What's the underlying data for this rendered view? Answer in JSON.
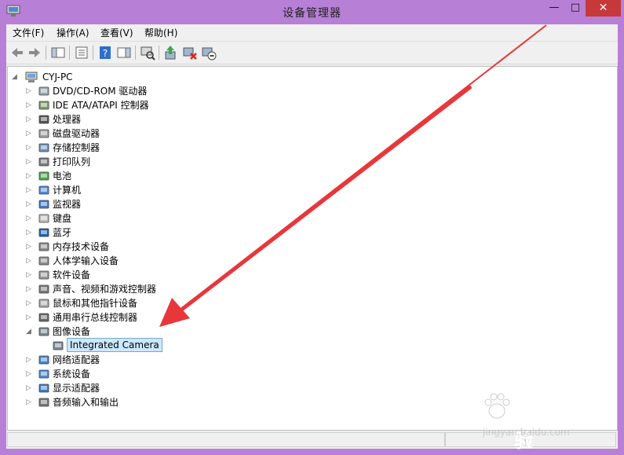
{
  "window": {
    "title": "设备管理器",
    "minimize_glyph": "—",
    "maximize_glyph": "□",
    "close_glyph": "✕"
  },
  "menu": [
    "文件(F)",
    "操作(A)",
    "查看(V)",
    "帮助(H)"
  ],
  "toolbar_icons": [
    "back-icon",
    "forward-icon",
    "show-hide-console-tree-icon",
    "properties-icon",
    "help-icon",
    "show-action-pane-icon",
    "scan-hardware-changes-icon",
    "update-driver-icon",
    "disable-device-icon",
    "uninstall-device-icon"
  ],
  "tree": {
    "root": "CYJ-PC",
    "categories": [
      {
        "label": "DVD/CD-ROM 驱动器",
        "icon": "dvd-drive-icon",
        "expanded": false
      },
      {
        "label": "IDE ATA/ATAPI 控制器",
        "icon": "ide-controller-icon",
        "expanded": false
      },
      {
        "label": "处理器",
        "icon": "processor-icon",
        "expanded": false
      },
      {
        "label": "磁盘驱动器",
        "icon": "disk-drive-icon",
        "expanded": false
      },
      {
        "label": "存储控制器",
        "icon": "storage-controller-icon",
        "expanded": false
      },
      {
        "label": "打印队列",
        "icon": "printer-icon",
        "expanded": false
      },
      {
        "label": "电池",
        "icon": "battery-icon",
        "expanded": false
      },
      {
        "label": "计算机",
        "icon": "computer-icon",
        "expanded": false
      },
      {
        "label": "监视器",
        "icon": "monitor-icon",
        "expanded": false
      },
      {
        "label": "键盘",
        "icon": "keyboard-icon",
        "expanded": false
      },
      {
        "label": "蓝牙",
        "icon": "bluetooth-icon",
        "expanded": false
      },
      {
        "label": "内存技术设备",
        "icon": "memory-device-icon",
        "expanded": false
      },
      {
        "label": "人体学输入设备",
        "icon": "hid-icon",
        "expanded": false
      },
      {
        "label": "软件设备",
        "icon": "software-device-icon",
        "expanded": false
      },
      {
        "label": "声音、视频和游戏控制器",
        "icon": "sound-icon",
        "expanded": false
      },
      {
        "label": "鼠标和其他指针设备",
        "icon": "mouse-icon",
        "expanded": false
      },
      {
        "label": "通用串行总线控制器",
        "icon": "usb-icon",
        "expanded": false
      },
      {
        "label": "图像设备",
        "icon": "imaging-device-icon",
        "expanded": true,
        "children": [
          {
            "label": "Integrated Camera",
            "icon": "camera-icon",
            "selected": true
          }
        ]
      },
      {
        "label": "网络适配器",
        "icon": "network-adapter-icon",
        "expanded": false
      },
      {
        "label": "系统设备",
        "icon": "system-device-icon",
        "expanded": false
      },
      {
        "label": "显示适配器",
        "icon": "display-adapter-icon",
        "expanded": false
      },
      {
        "label": "音频输入和输出",
        "icon": "audio-io-icon",
        "expanded": false
      }
    ]
  },
  "watermark": {
    "brand": "Bai du 经验",
    "url": "jingyan.baidu.com"
  },
  "colors": {
    "window_frame": "#b77fd6",
    "close_button": "#c7383b",
    "annotation_arrow": "#e8373a",
    "selection_fill": "#cce8ff"
  }
}
